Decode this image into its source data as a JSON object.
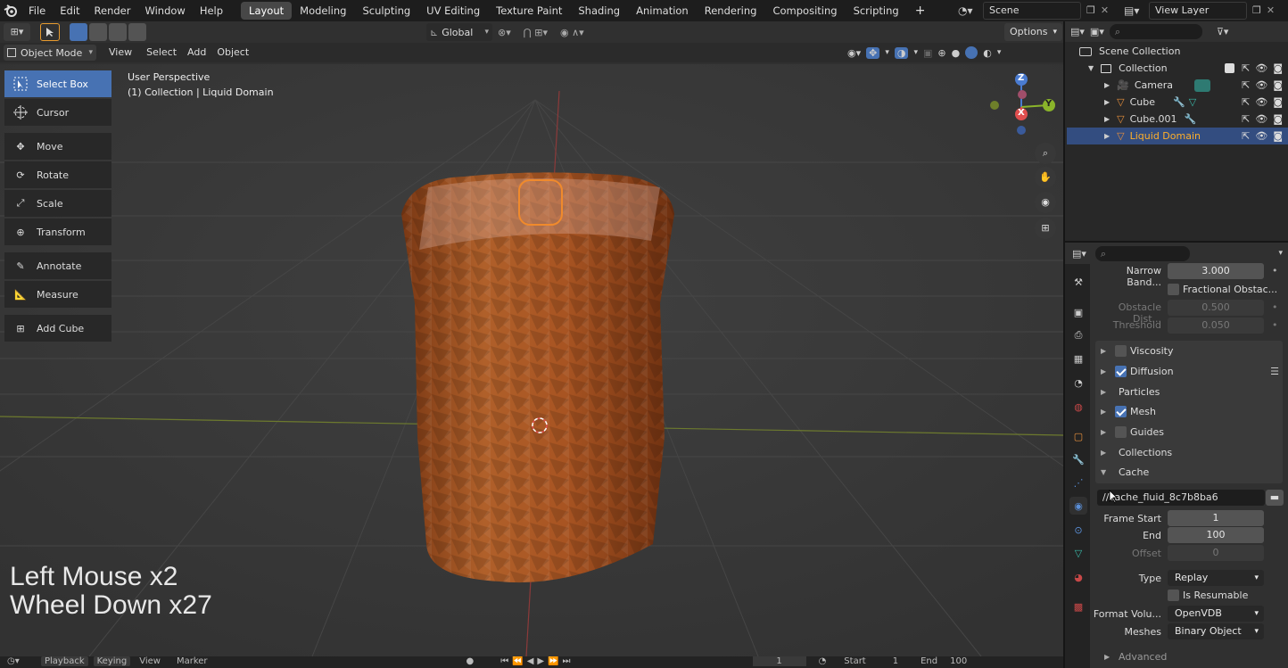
{
  "topbar": {
    "menus": [
      "File",
      "Edit",
      "Render",
      "Window",
      "Help"
    ],
    "workspaces": [
      "Layout",
      "Modeling",
      "Sculpting",
      "UV Editing",
      "Texture Paint",
      "Shading",
      "Animation",
      "Rendering",
      "Compositing",
      "Scripting"
    ],
    "active_workspace": "Layout",
    "add_tab": "+",
    "scene": "Scene",
    "view_layer": "View Layer"
  },
  "viewport_header": {
    "transform_orientation": "Global",
    "options": "Options",
    "mode": "Object Mode",
    "menus": [
      "View",
      "Select",
      "Add",
      "Object"
    ]
  },
  "viewport": {
    "perspective": "User Perspective",
    "collection_info": "(1) Collection | Liquid Domain",
    "overlay_line1": "Left Mouse x2",
    "overlay_line2": "Wheel Down x27",
    "gizmo": {
      "z": "Z",
      "y": "Y",
      "x": "X"
    }
  },
  "toolbar": [
    {
      "label": "Select Box",
      "icon": "select-box-icon",
      "active": true
    },
    {
      "label": "Cursor",
      "icon": "cursor-icon"
    },
    {
      "label": "Move",
      "icon": "move-icon"
    },
    {
      "label": "Rotate",
      "icon": "rotate-icon"
    },
    {
      "label": "Scale",
      "icon": "scale-icon"
    },
    {
      "label": "Transform",
      "icon": "transform-icon"
    },
    {
      "label": "Annotate",
      "icon": "annotate-icon"
    },
    {
      "label": "Measure",
      "icon": "measure-icon"
    },
    {
      "label": "Add Cube",
      "icon": "add-cube-icon"
    }
  ],
  "outliner": {
    "root": "Scene Collection",
    "collection": "Collection",
    "items": [
      "Camera",
      "Cube",
      "Cube.001",
      "Liquid Domain"
    ],
    "selected": "Liquid Domain"
  },
  "properties": {
    "narrow_band_label": "Narrow Band...",
    "narrow_band_value": "3.000",
    "fractional_label": "Fractional Obstac...",
    "obstacle_dist_label": "Obstacle Dist...",
    "obstacle_dist_value": "0.500",
    "threshold_label": "Threshold",
    "threshold_value": "0.050",
    "panels": {
      "viscosity": "Viscosity",
      "diffusion": "Diffusion",
      "particles": "Particles",
      "mesh": "Mesh",
      "guides": "Guides",
      "collections": "Collections",
      "cache": "Cache",
      "advanced": "Advanced"
    },
    "checked": {
      "viscosity": false,
      "diffusion": true,
      "mesh": true,
      "guides": false
    },
    "cache_path": "//cache_fluid_8c7b8ba6",
    "frame_start_label": "Frame Start",
    "frame_start": "1",
    "end_label": "End",
    "end": "100",
    "offset_label": "Offset",
    "offset": "0",
    "type_label": "Type",
    "type": "Replay",
    "is_resumable": "Is Resumable",
    "format_label": "Format Volu...",
    "format": "OpenVDB",
    "meshes_label": "Meshes",
    "meshes": "Binary Object"
  },
  "timeline": {
    "menus": [
      "Playback",
      "Keying",
      "View",
      "Marker"
    ],
    "current_frame": "1",
    "start_label": "Start",
    "start": "1",
    "end_label": "End",
    "end": "100"
  },
  "colors": {
    "accent": "#4772b3",
    "selected_row": "#334d80",
    "orange": "#e87d0d"
  }
}
